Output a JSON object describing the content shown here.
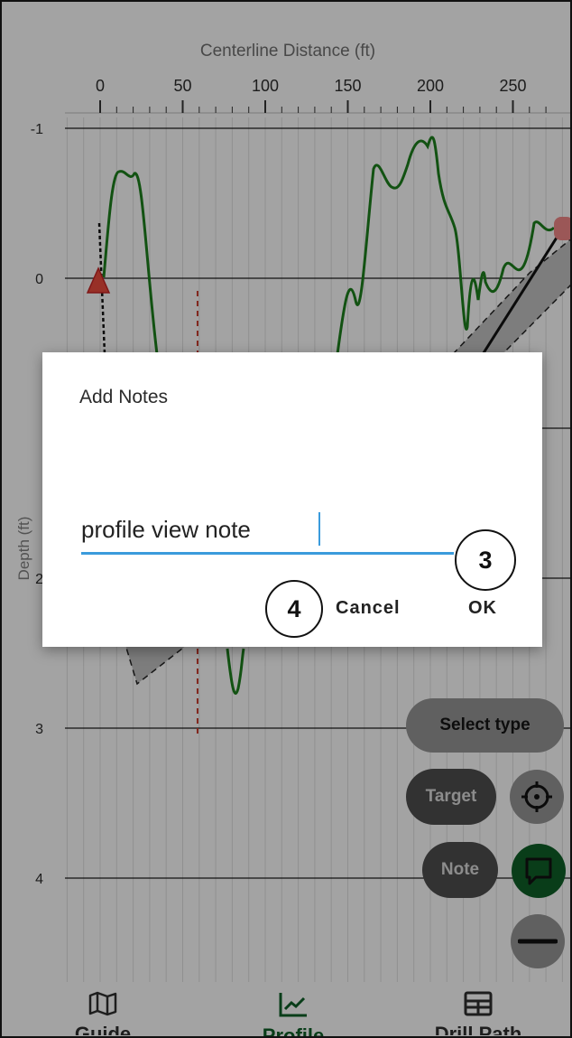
{
  "chart_data": {
    "type": "line",
    "xlabel": "Centerline Distance (ft)",
    "ylabel": "Depth (ft)",
    "x_ticks": [
      "0",
      "50",
      "100",
      "150",
      "200",
      "250"
    ],
    "y_ticks": [
      "-1",
      "0",
      "2",
      "3",
      "4"
    ],
    "xlim": [
      -5,
      278
    ],
    "ylim": [
      -1.2,
      4.7
    ],
    "grid": true
  },
  "dialog": {
    "title": "Add Notes",
    "input_value": "profile view note",
    "cancel_label": "Cancel",
    "ok_label": "OK"
  },
  "annotations": {
    "step3": "3",
    "step4": "4"
  },
  "fab": {
    "select_type_label": "Select type",
    "target_label": "Target",
    "note_label": "Note",
    "icons": [
      "crosshair-icon",
      "comment-icon",
      "line-icon"
    ]
  },
  "bottom_nav": {
    "items": [
      {
        "icon": "map-icon",
        "label": "Guide"
      },
      {
        "icon": "chart-line-icon",
        "label": "Profile",
        "active": true
      },
      {
        "icon": "table-icon",
        "label": "Drill Path"
      }
    ]
  },
  "colors": {
    "accent": "#3b9bdc",
    "green": "#1b7a1b",
    "dim_green": "#0e5a26",
    "warn": "#d0392b"
  }
}
